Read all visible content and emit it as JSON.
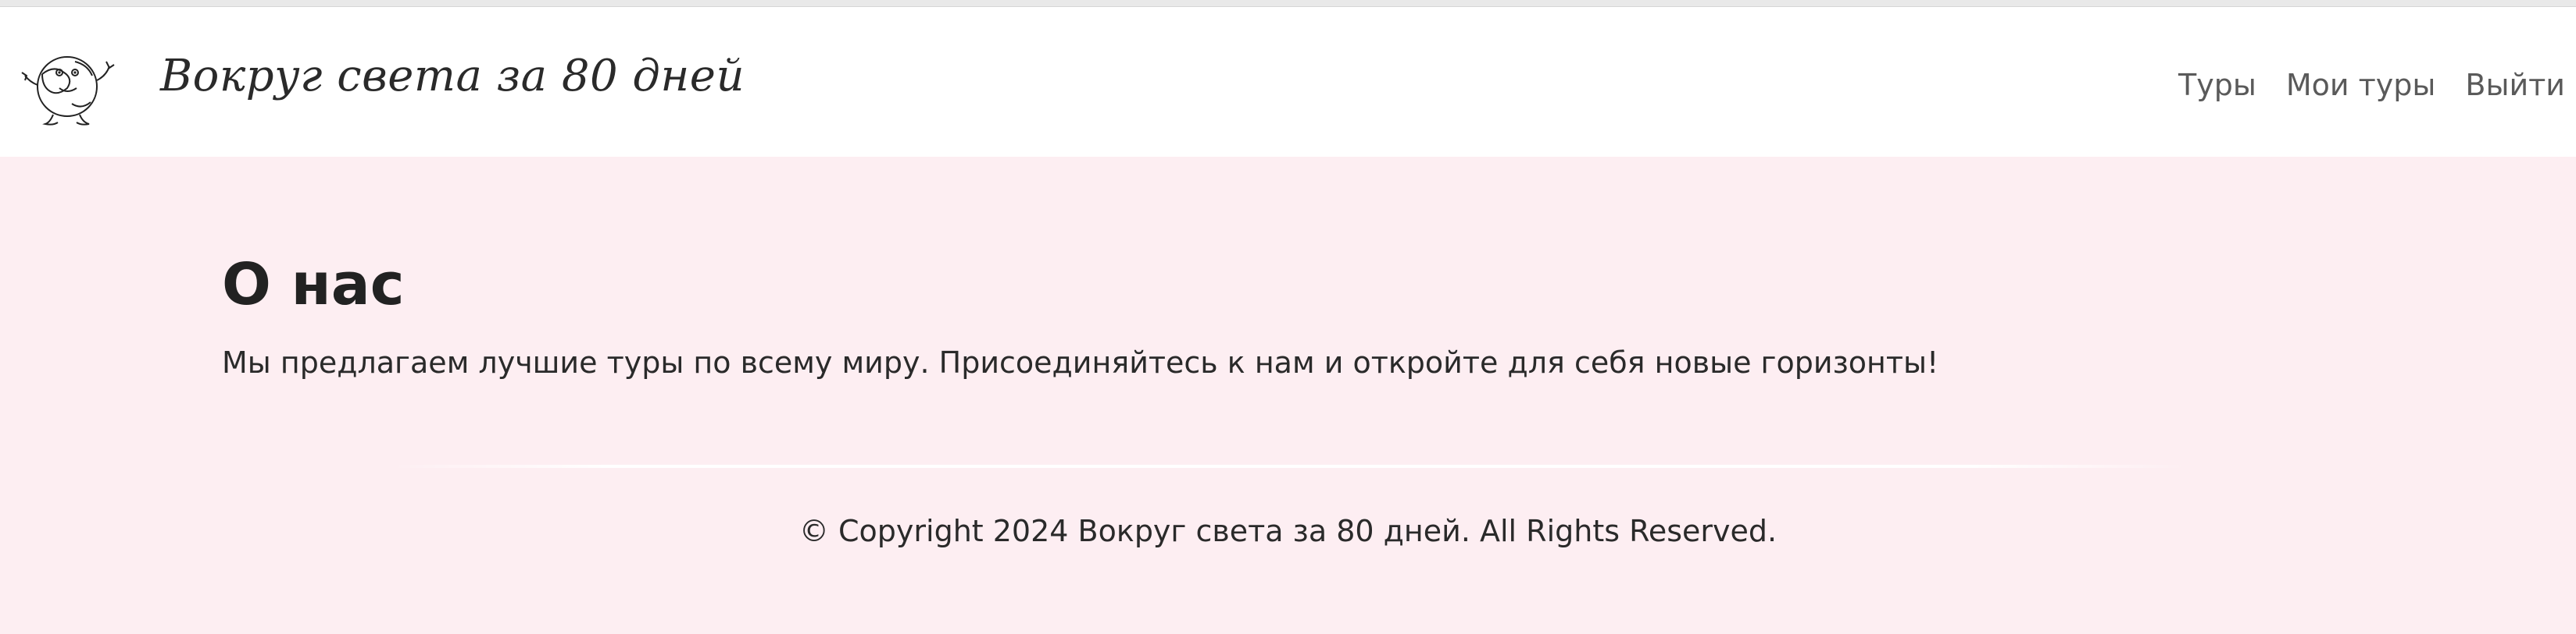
{
  "header": {
    "brand": "Вокруг света за 80 дней",
    "logo_icon": "cartoon-globe-icon"
  },
  "nav": {
    "items": [
      {
        "label": "Туры"
      },
      {
        "label": "Мои туры"
      },
      {
        "label": "Выйти"
      }
    ]
  },
  "main": {
    "title": "О нас",
    "description": "Мы предлагаем лучшие туры по всему миру. Присоединяйтесь к нам и откройте для себя новые горизонты!"
  },
  "footer": {
    "copyright": "© Copyright 2024 Вокруг света за 80 дней. All Rights Reserved."
  },
  "colors": {
    "header_bg": "#ffffff",
    "page_bg": "#fdeef2",
    "text": "#222222",
    "nav_text": "#5a5a5a"
  }
}
